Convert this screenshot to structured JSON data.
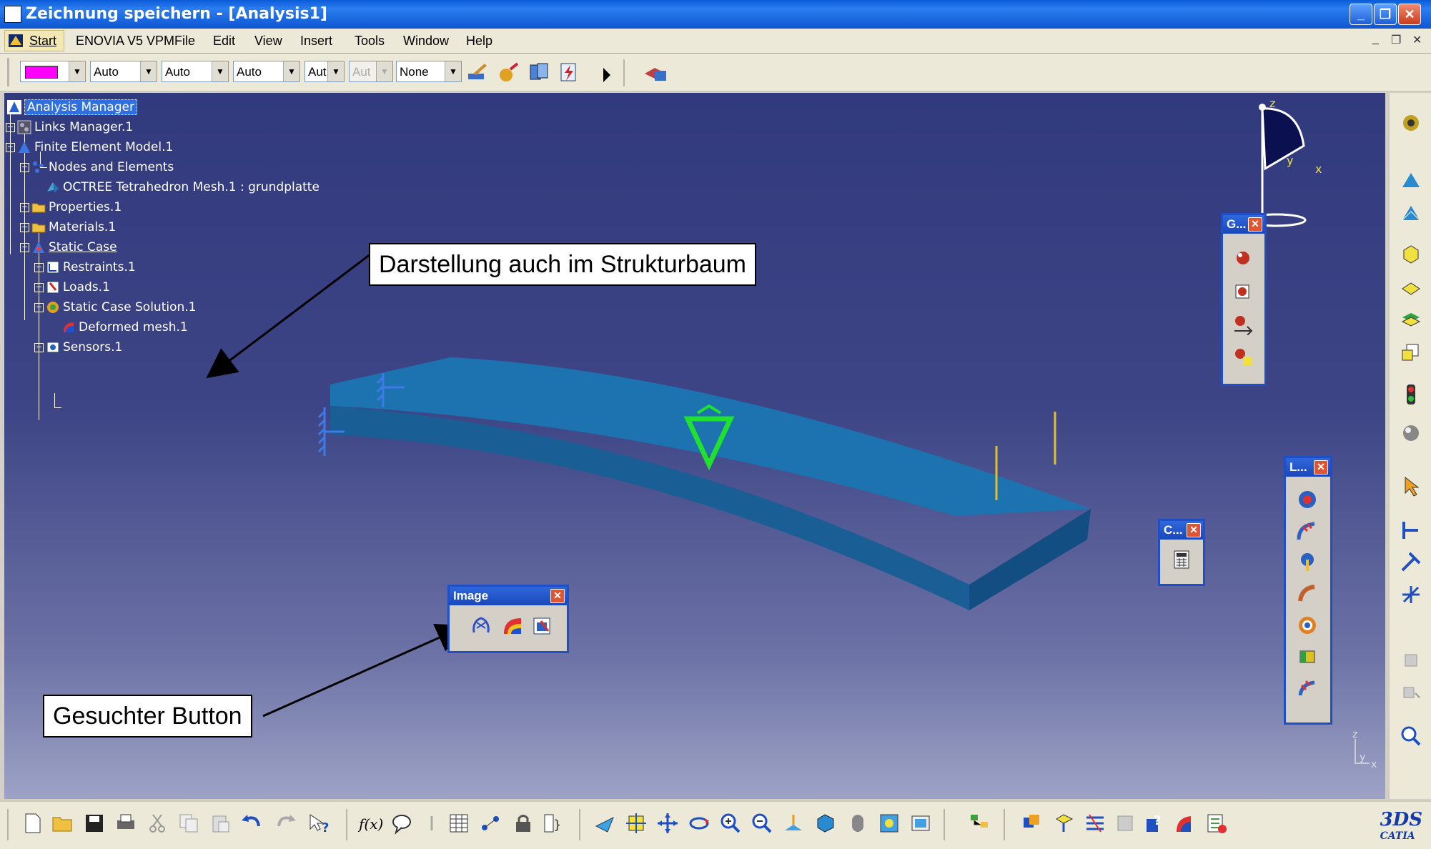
{
  "window": {
    "title": "Zeichnung speichern - [Analysis1]",
    "min_label": "_",
    "max_label": "❐",
    "close_label": "✕"
  },
  "menu": {
    "items": [
      "Start",
      "ENOVIA V5 VPM",
      "File",
      "Edit",
      "View",
      "Insert",
      "Tools",
      "Window",
      "Help"
    ],
    "mdi_min": "_",
    "mdi_restore": "❐",
    "mdi_close": "✕"
  },
  "toolbar": {
    "color_value": "#ff00ff",
    "combos": [
      "Auto",
      "Auto",
      "Auto",
      "Aut",
      "Aut",
      "None"
    ]
  },
  "tree": {
    "nodes": [
      {
        "label": "Analysis Manager"
      },
      {
        "label": "Links Manager.1"
      },
      {
        "label": "Finite Element Model.1"
      },
      {
        "label": "Nodes and Elements"
      },
      {
        "label": "OCTREE Tetrahedron Mesh.1 : grundplatte"
      },
      {
        "label": "Properties.1"
      },
      {
        "label": "Materials.1"
      },
      {
        "label": "Static Case"
      },
      {
        "label": "Restraints.1"
      },
      {
        "label": "Loads.1"
      },
      {
        "label": "Static Case Solution.1"
      },
      {
        "label": "Deformed mesh.1"
      },
      {
        "label": "Sensors.1"
      }
    ]
  },
  "callouts": {
    "tree_note": "Darstellung auch im Strukturbaum",
    "button_note": "Gesuchter Button"
  },
  "palettes": {
    "image": {
      "title": "Image"
    },
    "g": {
      "title": "G..."
    },
    "l": {
      "title": "L..."
    },
    "c": {
      "title": "C..."
    },
    "close_label": "✕"
  },
  "compass": {
    "z": "z",
    "y": "y",
    "x": "x"
  },
  "mini_axis": {
    "z": "z",
    "y": "y",
    "x": "x"
  },
  "brand": {
    "logo_text": "CATIA"
  },
  "colors": {
    "titlebar": "#0a5bd8",
    "viewport_top": "#323a7e",
    "part": "#1a6aa8",
    "selection": "#2f6fe0",
    "palette_border": "#1f4fc6"
  }
}
